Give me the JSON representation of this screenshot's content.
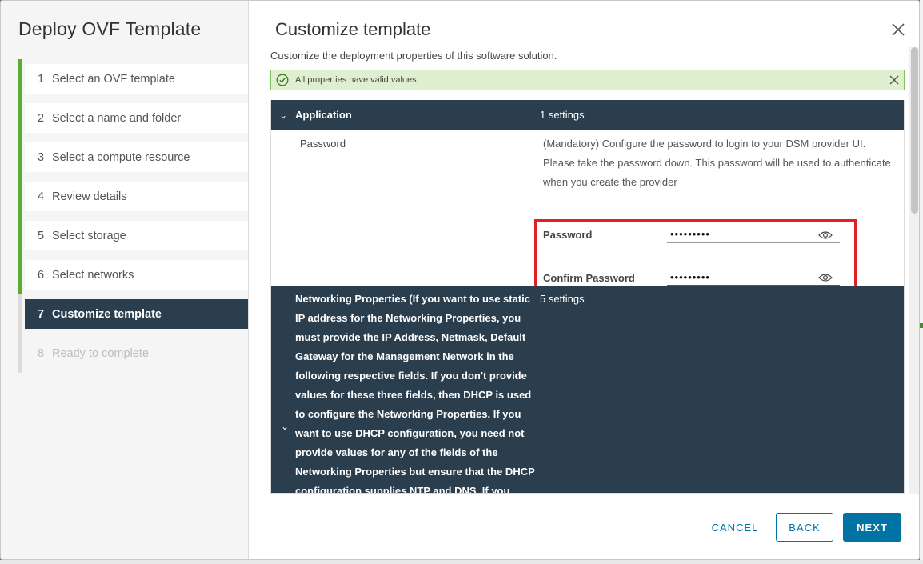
{
  "wizard": {
    "title": "Deploy OVF Template",
    "steps": [
      {
        "num": "1",
        "label": "Select an OVF template",
        "state": "done"
      },
      {
        "num": "2",
        "label": "Select a name and folder",
        "state": "done"
      },
      {
        "num": "3",
        "label": "Select a compute resource",
        "state": "done"
      },
      {
        "num": "4",
        "label": "Review details",
        "state": "done"
      },
      {
        "num": "5",
        "label": "Select storage",
        "state": "done"
      },
      {
        "num": "6",
        "label": "Select networks",
        "state": "done"
      },
      {
        "num": "7",
        "label": "Customize template",
        "state": "active"
      },
      {
        "num": "8",
        "label": "Ready to complete",
        "state": "disabled"
      }
    ]
  },
  "main": {
    "title": "Customize template",
    "subtitle": "Customize the deployment properties of this software solution.",
    "alert": "All properties have valid values",
    "application": {
      "name": "Application",
      "count": "1 settings",
      "prop_name": "Password",
      "prop_desc": "(Mandatory) Configure the password to login to your DSM provider UI. Please take the password down. This password will be used to authenticate when you create the provider",
      "password_label": "Password",
      "password_value": "•••••••••",
      "confirm_label": "Confirm Password",
      "confirm_value": "•••••••••"
    },
    "networking": {
      "name": "Networking Properties (If you want to use static IP address for the Networking Properties, you must provide the IP Address, Netmask, Default Gateway for the Management Network in the following respective fields. If you don't provide values for these three fields, then DHCP is used to configure the Networking Properties. If you want to use DHCP configuration, you need not provide values for any of the fields of the Networking Properties but ensure that the DHCP configuration supplies NTP and DNS. If you",
      "count": "5 settings"
    }
  },
  "footer": {
    "cancel": "CANCEL",
    "back": "BACK",
    "next": "NEXT"
  },
  "colors": {
    "accent": "#0072a3",
    "header_dark": "#2b3e4e",
    "done_green": "#5aad34",
    "highlight_red": "#e02025"
  }
}
